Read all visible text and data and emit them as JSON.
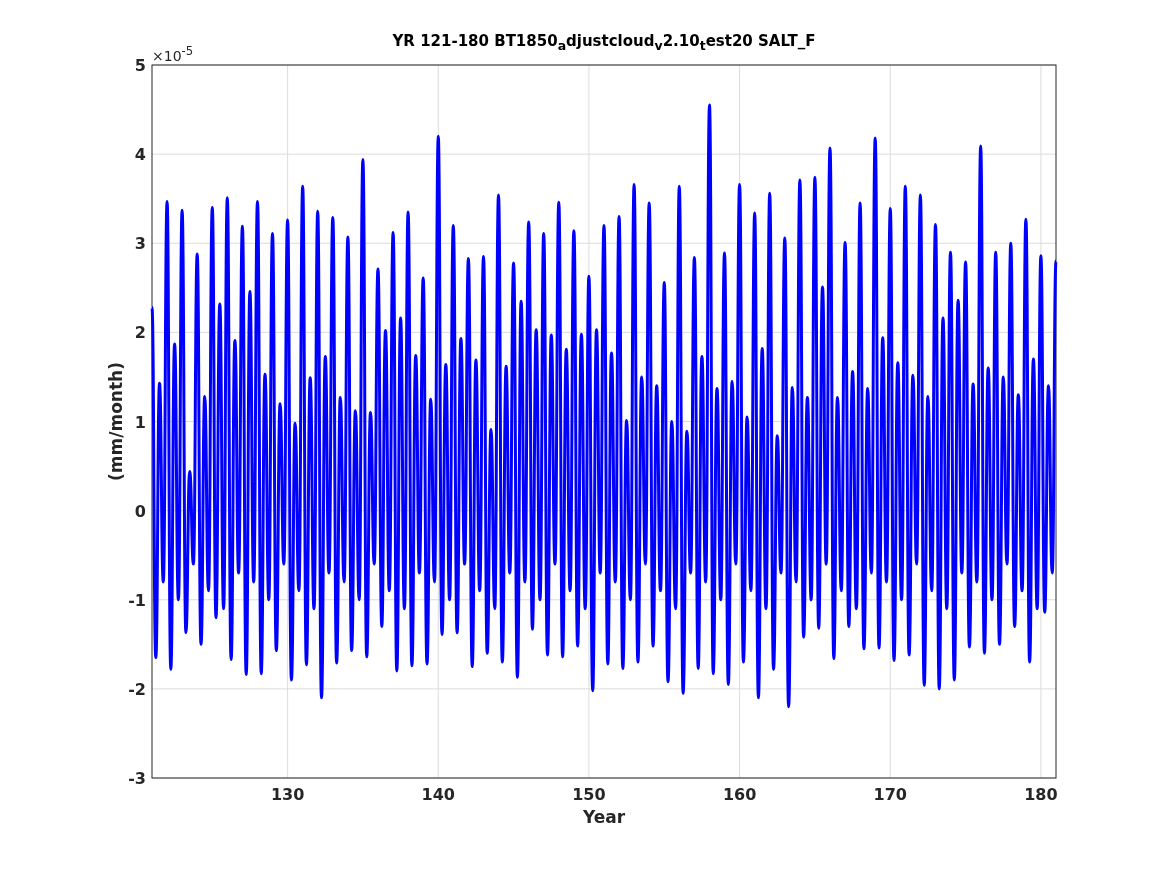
{
  "figure": {
    "exponent": "×10$^{-5}$",
    "chart_data": {
      "type": "line",
      "title": "YR 121-180 BT1850$_{a}$djustcloud$_{v}$2.10$_{t}$est20 SALT_F",
      "xlabel": "Year",
      "ylabel": "(mm/month)",
      "xlim": [
        121,
        181
      ],
      "ylim": [
        -3,
        5
      ],
      "xticks": [
        130,
        140,
        150,
        160,
        170,
        180
      ],
      "yticks": [
        -3,
        -2,
        -1,
        0,
        1,
        2,
        3,
        4,
        5
      ],
      "grid": true,
      "x": [
        121,
        121.25,
        121.5,
        121.75,
        122,
        122.25,
        122.5,
        122.75,
        123,
        123.25,
        123.5,
        123.75,
        124,
        124.25,
        124.5,
        124.75,
        125,
        125.25,
        125.5,
        125.75,
        126,
        126.25,
        126.5,
        126.75,
        127,
        127.25,
        127.5,
        127.75,
        128,
        128.25,
        128.5,
        128.75,
        129,
        129.25,
        129.5,
        129.75,
        130,
        130.25,
        130.5,
        130.75,
        131,
        131.25,
        131.5,
        131.75,
        132,
        132.25,
        132.5,
        132.75,
        133,
        133.25,
        133.5,
        133.75,
        134,
        134.25,
        134.5,
        134.75,
        135,
        135.25,
        135.5,
        135.75,
        136,
        136.25,
        136.5,
        136.75,
        137,
        137.25,
        137.5,
        137.75,
        138,
        138.25,
        138.5,
        138.75,
        139,
        139.25,
        139.5,
        139.75,
        140,
        140.25,
        140.5,
        140.75,
        141,
        141.25,
        141.5,
        141.75,
        142,
        142.25,
        142.5,
        142.75,
        143,
        143.25,
        143.5,
        143.75,
        144,
        144.25,
        144.5,
        144.75,
        145,
        145.25,
        145.5,
        145.75,
        146,
        146.25,
        146.5,
        146.75,
        147,
        147.25,
        147.5,
        147.75,
        148,
        148.25,
        148.5,
        148.75,
        149,
        149.25,
        149.5,
        149.75,
        150,
        150.25,
        150.5,
        150.75,
        151,
        151.25,
        151.5,
        151.75,
        152,
        152.25,
        152.5,
        152.75,
        153,
        153.25,
        153.5,
        153.75,
        154,
        154.25,
        154.5,
        154.75,
        155,
        155.25,
        155.5,
        155.75,
        156,
        156.25,
        156.5,
        156.75,
        157,
        157.25,
        157.5,
        157.75,
        158,
        158.25,
        158.5,
        158.75,
        159,
        159.25,
        159.5,
        159.75,
        160,
        160.25,
        160.5,
        160.75,
        161,
        161.25,
        161.5,
        161.75,
        162,
        162.25,
        162.5,
        162.75,
        163,
        163.25,
        163.5,
        163.75,
        164,
        164.25,
        164.5,
        164.75,
        165,
        165.25,
        165.5,
        165.75,
        166,
        166.25,
        166.5,
        166.75,
        167,
        167.25,
        167.5,
        167.75,
        168,
        168.25,
        168.5,
        168.75,
        169,
        169.25,
        169.5,
        169.75,
        170,
        170.25,
        170.5,
        170.75,
        171,
        171.25,
        171.5,
        171.75,
        172,
        172.25,
        172.5,
        172.75,
        173,
        173.25,
        173.5,
        173.75,
        174,
        174.25,
        174.5,
        174.75,
        175,
        175.25,
        175.5,
        175.75,
        176,
        176.25,
        176.5,
        176.75,
        177,
        177.25,
        177.5,
        177.75,
        178,
        178.25,
        178.5,
        178.75,
        179,
        179.25,
        179.5,
        179.75,
        180,
        180.25,
        180.5,
        180.75,
        181
      ],
      "series": [
        {
          "color": "#0000ff",
          "values": [
            2.28,
            -1.65,
            1.43,
            -0.8,
            3.47,
            -1.78,
            1.87,
            -1.0,
            3.37,
            -1.37,
            0.44,
            -0.6,
            2.88,
            -1.5,
            1.28,
            -0.9,
            3.4,
            -1.2,
            2.32,
            -1.1,
            3.51,
            -1.67,
            1.91,
            -0.7,
            3.19,
            -1.84,
            2.46,
            -0.8,
            3.47,
            -1.83,
            1.53,
            -1.0,
            3.11,
            -1.57,
            1.2,
            -0.6,
            3.26,
            -1.9,
            0.98,
            -0.9,
            3.64,
            -1.73,
            1.49,
            -1.1,
            3.36,
            -2.1,
            1.73,
            -0.7,
            3.29,
            -1.71,
            1.27,
            -0.8,
            3.07,
            -1.57,
            1.12,
            -1.0,
            3.94,
            -1.64,
            1.1,
            -0.6,
            2.71,
            -1.3,
            2.02,
            -0.9,
            3.12,
            -1.8,
            2.16,
            -1.1,
            3.35,
            -1.74,
            1.74,
            -0.7,
            2.61,
            -1.72,
            1.25,
            -0.8,
            4.2,
            -1.39,
            1.64,
            -1.0,
            3.2,
            -1.37,
            1.93,
            -0.6,
            2.83,
            -1.75,
            1.69,
            -0.9,
            2.85,
            -1.6,
            0.91,
            -1.1,
            3.54,
            -1.7,
            1.62,
            -0.7,
            2.78,
            -1.87,
            2.35,
            -0.8,
            3.24,
            -1.33,
            2.03,
            -1.0,
            3.11,
            -1.62,
            1.97,
            -0.6,
            3.46,
            -1.64,
            1.81,
            -0.9,
            3.14,
            -1.52,
            1.98,
            -1.1,
            2.63,
            -2.02,
            2.03,
            -0.7,
            3.2,
            -1.72,
            1.77,
            -0.8,
            3.3,
            -1.77,
            1.01,
            -1.0,
            3.66,
            -1.7,
            1.5,
            -0.6,
            3.45,
            -1.52,
            1.4,
            -0.9,
            2.56,
            -1.92,
            1.0,
            -1.1,
            3.64,
            -2.05,
            0.89,
            -0.7,
            2.84,
            -1.77,
            1.73,
            -0.8,
            4.55,
            -1.83,
            1.37,
            -1.0,
            2.89,
            -1.95,
            1.45,
            -0.6,
            3.66,
            -1.7,
            1.05,
            -0.9,
            3.34,
            -2.1,
            1.82,
            -1.1,
            3.56,
            -1.78,
            0.84,
            -0.7,
            3.06,
            -2.2,
            1.38,
            -0.8,
            3.71,
            -1.42,
            1.27,
            -1.0,
            3.74,
            -1.32,
            2.51,
            -0.6,
            4.07,
            -1.66,
            1.27,
            -0.9,
            3.01,
            -1.3,
            1.56,
            -1.1,
            3.45,
            -1.55,
            1.37,
            -0.7,
            4.18,
            -1.54,
            1.94,
            -0.8,
            3.39,
            -1.68,
            1.66,
            -1.0,
            3.64,
            -1.62,
            1.52,
            -0.6,
            3.54,
            -1.96,
            1.28,
            -0.9,
            3.21,
            -2.0,
            2.16,
            -1.1,
            2.9,
            -1.9,
            2.36,
            -0.7,
            2.79,
            -1.53,
            1.42,
            -0.8,
            4.09,
            -1.6,
            1.6,
            -1.0,
            2.9,
            -1.5,
            1.5,
            -0.6,
            3.0,
            -1.3,
            1.3,
            -0.9,
            3.27,
            -1.7,
            1.7,
            -1.1,
            2.86,
            -1.14,
            1.4,
            -0.7,
            2.8
          ]
        }
      ]
    }
  }
}
